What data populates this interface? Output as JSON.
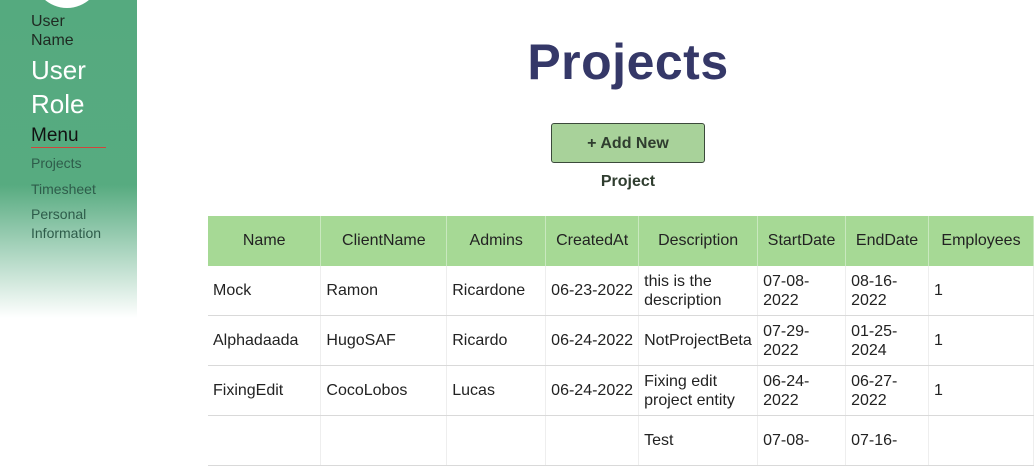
{
  "sidebar": {
    "user_name": "User Name",
    "user_role": "User Role",
    "menu_title": "Menu",
    "items": [
      {
        "label": "Projects"
      },
      {
        "label": "Timesheet"
      },
      {
        "label": "Personal Information"
      }
    ]
  },
  "main": {
    "title": "Projects",
    "add_button_label": "+ Add New Project"
  },
  "table": {
    "headers": [
      "Name",
      "ClientName",
      "Admins",
      "CreatedAt",
      "Description",
      "StartDate",
      "EndDate",
      "Employees"
    ],
    "rows": [
      [
        "Mock",
        "Ramon",
        "Ricardone",
        "06-23-2022",
        "this is the description",
        "07-08-2022",
        "08-16-2022",
        "1"
      ],
      [
        "Alphadaada",
        "HugoSAF",
        "Ricardo",
        "06-24-2022",
        "NotProjectBeta",
        "07-29-2022",
        "01-25-2024",
        "1"
      ],
      [
        "FixingEdit",
        "CocoLobos",
        "Lucas",
        "06-24-2022",
        "Fixing edit project entity",
        "06-24-2022",
        "06-27-2022",
        "1"
      ],
      [
        "",
        "",
        "",
        "",
        "Test",
        "07-08-",
        "07-16-",
        ""
      ]
    ]
  },
  "colors": {
    "sidebar_green": "#55aa7f",
    "header_green": "#a6d995",
    "title_navy": "#353868",
    "button_green": "#a8d29a"
  }
}
